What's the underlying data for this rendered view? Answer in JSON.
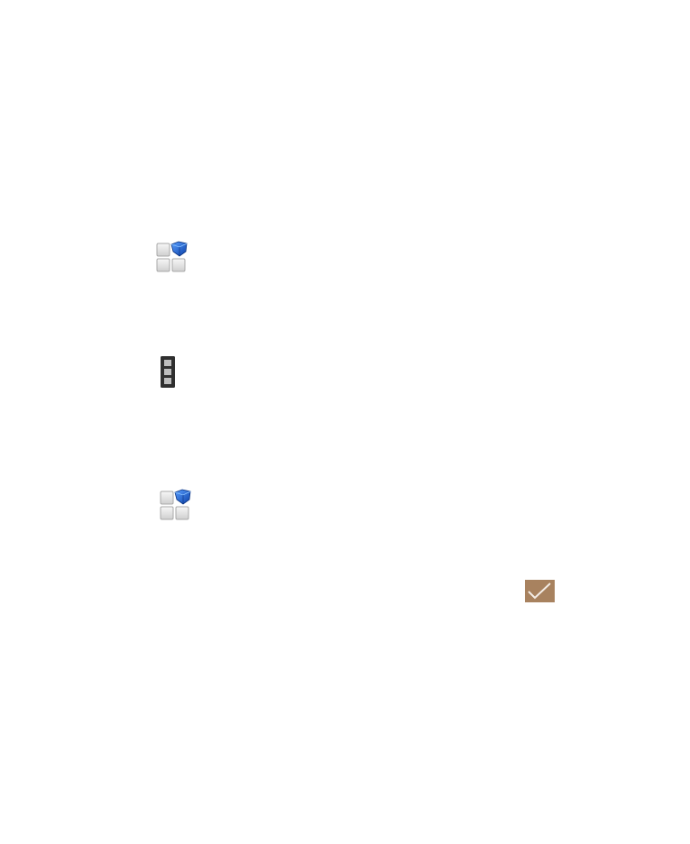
{
  "icons": [
    {
      "name": "apps-icon",
      "accent": "#1d5fd1"
    },
    {
      "name": "menu-icon",
      "color": "#3a3a3a"
    },
    {
      "name": "apps-icon",
      "accent": "#1d5fd1"
    },
    {
      "name": "checkmark-icon",
      "background": "#a8825f"
    }
  ]
}
